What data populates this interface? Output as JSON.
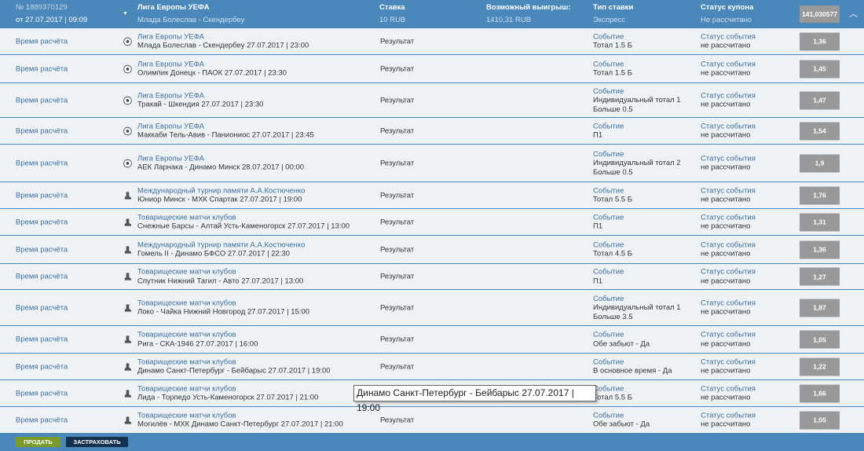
{
  "coupon": {
    "number": "№ 1889370129",
    "date": "от 27.07.2017 | 09:09",
    "league": "Лига Европы УЕФА",
    "match": "Млада Болеслав - Скендербеу",
    "stake_label": "Ставка",
    "stake": "10 RUB",
    "win_label": "Возможный выигрыш:",
    "win": "1410,31 RUB",
    "type_label": "Тип ставки",
    "type": "Экспресс",
    "status_label": "Статус купона",
    "status": "Не рассчитано",
    "total_odds": "141,030577"
  },
  "rows": [
    {
      "time": "Время расчёта",
      "sport": "soccer",
      "league": "Лига Европы УЕФА",
      "match": "Млада Болеслав - Скендербеу 27.07.2017 | 23:00",
      "result": "Результат",
      "bet": [
        "Событие",
        "Тотал 1.5 Б"
      ],
      "status": [
        "Статус события",
        "не рассчитано"
      ],
      "odds": "1,36"
    },
    {
      "time": "Время расчёта",
      "sport": "soccer",
      "league": "Лига Европы УЕФА",
      "match": "Олимпик Донецк - ПАОК 27.07.2017 | 23:30",
      "result": "Результат",
      "bet": [
        "Событие",
        "Тотал 1.5 Б"
      ],
      "status": [
        "Статус события",
        "не рассчитано"
      ],
      "odds": "1,45"
    },
    {
      "time": "Время расчёта",
      "sport": "soccer",
      "league": "Лига Европы УЕФА",
      "match": "Тракай - Шкендия 27.07.2017 | 23:30",
      "result": "Результат",
      "bet": [
        "Событие",
        "Индивидуальный тотал 1",
        "Больше 0.5"
      ],
      "status": [
        "Статус события",
        "не рассчитано"
      ],
      "odds": "1,47"
    },
    {
      "time": "Время расчёта",
      "sport": "soccer",
      "league": "Лига Европы УЕФА",
      "match": "Маккаби Тель-Авив - Паниониос 27.07.2017 | 23:45",
      "result": "Результат",
      "bet": [
        "Событие",
        "П1"
      ],
      "status": [
        "Статус события",
        "не рассчитано"
      ],
      "odds": "1,54"
    },
    {
      "time": "Время расчёта",
      "sport": "soccer",
      "league": "Лига Европы УЕФА",
      "match": "АЕК Ларнака - Динамо Минск 28.07.2017 | 00:00",
      "result": "Результат",
      "bet": [
        "Событие",
        "Индивидуальный тотал 2",
        "Больше 0.5"
      ],
      "status": [
        "Статус события",
        "не рассчитано"
      ],
      "odds": "1,9"
    },
    {
      "time": "Время расчёта",
      "sport": "hockey",
      "league": "Международный турнир памяти А.А.Костюченко",
      "match": "Юниор Минск - МХК Спартак 27.07.2017 | 19:00",
      "result": "Результат",
      "bet": [
        "Событие",
        "Тотал 5.5 Б"
      ],
      "status": [
        "Статус события",
        "не рассчитано"
      ],
      "odds": "1,76"
    },
    {
      "time": "Время расчёта",
      "sport": "hockey",
      "league": "Товарищеские матчи клубов",
      "match": "Снежные Барсы - Алтай Усть-Каменогорск 27.07.2017 | 13:00",
      "result": "Результат",
      "bet": [
        "Событие",
        "П1"
      ],
      "status": [
        "Статус события",
        "не рассчитано"
      ],
      "odds": "1,31"
    },
    {
      "time": "Время расчёта",
      "sport": "hockey",
      "league": "Международный турнир памяти А.А.Костюченко",
      "match": "Гомель II - Динамо БФСО 27.07.2017 | 22:30",
      "result": "Результат",
      "bet": [
        "Событие",
        "Тотал 4.5 Б"
      ],
      "status": [
        "Статус события",
        "не рассчитано"
      ],
      "odds": "1,36"
    },
    {
      "time": "Время расчёта",
      "sport": "hockey",
      "league": "Товарищеские матчи клубов",
      "match": "Спутник Нижний Тагил - Авто 27.07.2017 | 13:00",
      "result": "Результат",
      "bet": [
        "Событие",
        "П1"
      ],
      "status": [
        "Статус события",
        "не рассчитано"
      ],
      "odds": "1,27"
    },
    {
      "time": "Время расчёта",
      "sport": "hockey",
      "league": "Товарищеские матчи клубов",
      "match": "Локо - Чайка Нижний Новгород 27.07.2017 | 15:00",
      "result": "Результат",
      "bet": [
        "Событие",
        "Индивидуальный тотал 1",
        "Больше 3.5"
      ],
      "status": [
        "Статус события",
        "не рассчитано"
      ],
      "odds": "1,87"
    },
    {
      "time": "Время расчёта",
      "sport": "hockey",
      "league": "Товарищеские матчи клубов",
      "match": "Рига - СКА-1946 27.07.2017 | 16:00",
      "result": "Результат",
      "bet": [
        "Событие",
        "Обе забьют - Да"
      ],
      "status": [
        "Статус события",
        "не рассчитано"
      ],
      "odds": "1,05"
    },
    {
      "time": "Время расчёта",
      "sport": "hockey",
      "league": "Товарищеские матчи клубов",
      "match": "Динамо Санкт-Петербург - Бейбарыс 27.07.2017 | 19:00",
      "result": "Результат",
      "bet": [
        "Событие",
        "В основное время - Да"
      ],
      "status": [
        "Статус события",
        "не рассчитано"
      ],
      "odds": "1,22"
    },
    {
      "time": "Время расчёта",
      "sport": "hockey",
      "league": "Товарищеские матчи клубов",
      "match": "Лида - Торпедо Усть-Каменогорск 27.07.2017 | 21:00",
      "result": "Результат",
      "bet": [
        "Событие",
        "Тотал 5.5 Б"
      ],
      "status": [
        "Статус события",
        "не рассчитано"
      ],
      "odds": "1,66"
    },
    {
      "time": "Время расчёта",
      "sport": "hockey",
      "league": "Товарищеские матчи клубов",
      "match": "Могилёв - МХК Динамо Санкт-Петербург 27.07.2017 | 21:00",
      "result": "Результат",
      "bet": [
        "Событие",
        "Обе забьют - Да"
      ],
      "status": [
        "Статус события",
        "не рассчитано"
      ],
      "odds": "1,05"
    }
  ],
  "tooltip": "Динамо Санкт-Петербург - Бейбарыс 27.07.2017 | 19:00",
  "footer": {
    "sell": "ПРОДАТЬ",
    "insure": "ЗАСТРАХОВАТЬ"
  },
  "colors": {
    "header": "#4a87bb",
    "sell": "#7a9a2a",
    "insure": "#13304f",
    "odds_bg": "#999999"
  }
}
